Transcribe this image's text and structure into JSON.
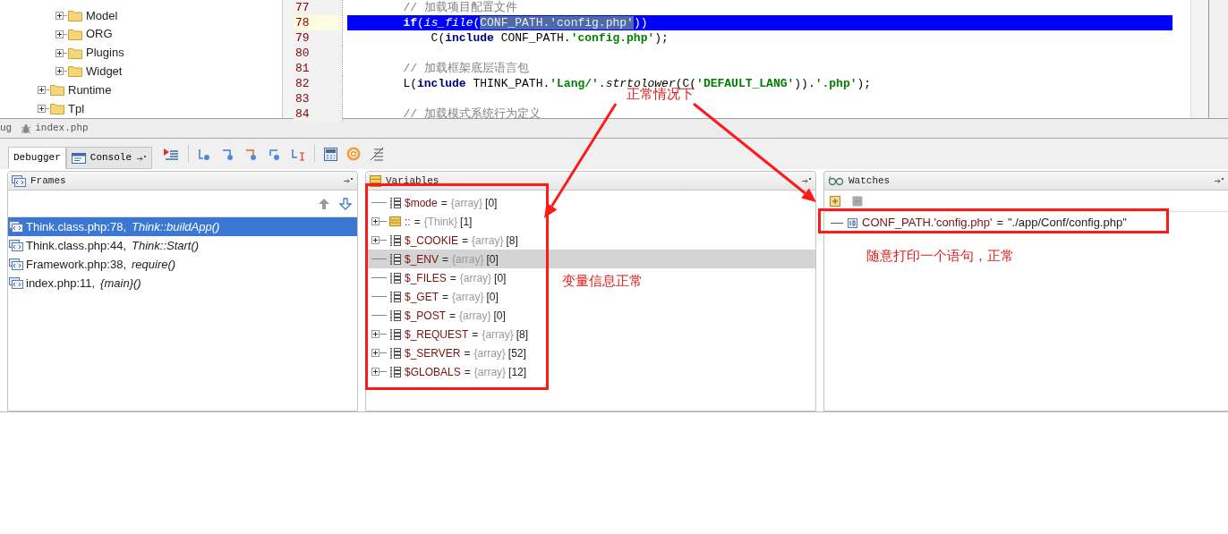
{
  "file_tree": [
    {
      "children": [
        {
          "label": "Model",
          "expanded": false
        },
        {
          "label": "ORG",
          "expanded": false
        },
        {
          "label": "Plugins",
          "expanded": false
        },
        {
          "label": "Widget",
          "expanded": false
        }
      ]
    },
    {
      "label": "Runtime",
      "expanded": false
    },
    {
      "label": "Tpl",
      "expanded": false
    }
  ],
  "editor": {
    "lines": [
      {
        "number": "77",
        "current": false,
        "tokens": [
          {
            "kind": "comment",
            "text": "        // 加载项目配置文件"
          }
        ]
      },
      {
        "number": "78",
        "current": true,
        "tokens": [
          {
            "kind": "keyword",
            "text": "        if"
          },
          {
            "kind": "plain",
            "text": "("
          },
          {
            "kind": "call",
            "text": "is_file"
          },
          {
            "kind": "plain",
            "text": "("
          },
          {
            "kind": "selected",
            "text": "CONF_PATH.'config.php'"
          },
          {
            "kind": "plain",
            "text": "))"
          }
        ]
      },
      {
        "number": "79",
        "current": false,
        "tokens": [
          {
            "kind": "plain",
            "text": "            C("
          },
          {
            "kind": "keyword",
            "text": "include"
          },
          {
            "kind": "plain",
            "text": " CONF_PATH."
          },
          {
            "kind": "string",
            "text": "'config.php'"
          },
          {
            "kind": "plain",
            "text": ");"
          }
        ]
      },
      {
        "number": "80",
        "current": false
      },
      {
        "number": "81",
        "current": false,
        "tokens": [
          {
            "kind": "comment",
            "text": "        // 加载框架底层语言包"
          }
        ]
      },
      {
        "number": "82",
        "current": false,
        "tokens": [
          {
            "kind": "plain",
            "text": "        L("
          },
          {
            "kind": "keyword",
            "text": "include"
          },
          {
            "kind": "plain",
            "text": " THINK_PATH."
          },
          {
            "kind": "string",
            "text": "'Lang/'"
          },
          {
            "kind": "plain",
            "text": "."
          },
          {
            "kind": "call",
            "text": "strtolower"
          },
          {
            "kind": "plain",
            "text": "(C("
          },
          {
            "kind": "string",
            "text": "'DEFAULT_LANG'"
          },
          {
            "kind": "plain",
            "text": "))."
          },
          {
            "kind": "string",
            "text": "'.php'"
          },
          {
            "kind": "plain",
            "text": ");"
          }
        ]
      },
      {
        "number": "83",
        "current": false
      },
      {
        "number": "84",
        "current": false,
        "tokens": [
          {
            "kind": "comment",
            "text": "        // 加载模式系统行为定义"
          }
        ]
      }
    ]
  },
  "session_tabs": [
    {
      "label": "ug"
    },
    {
      "label": "index.php"
    }
  ],
  "debug_tabs": [
    {
      "label": "Debugger",
      "selected": true
    },
    {
      "label": "Console",
      "selected": false
    }
  ],
  "frames": {
    "title": "Frames",
    "rows": [
      {
        "location": "Think.class.php:78,",
        "function": "Think::buildApp()",
        "selected": true
      },
      {
        "location": "Think.class.php:44,",
        "function": "Think::Start()",
        "selected": false
      },
      {
        "location": "Framework.php:38,",
        "function": "require()",
        "selected": false
      },
      {
        "location": "index.php:11,",
        "function": "{main}()",
        "selected": false
      }
    ]
  },
  "variables": {
    "title": "Variables",
    "rows": [
      {
        "kind": "array",
        "name": "$mode",
        "operator": "=",
        "type": "{array}",
        "count": "[0]",
        "expandable": false,
        "selected": false
      },
      {
        "kind": "object",
        "name": "::",
        "operator": "=",
        "type": "{Think}",
        "count": "[1]",
        "expandable": true,
        "selected": false
      },
      {
        "kind": "array",
        "name": "$_COOKIE",
        "operator": "=",
        "type": "{array}",
        "count": "[8]",
        "expandable": true,
        "selected": false
      },
      {
        "kind": "array",
        "name": "$_ENV",
        "operator": "=",
        "type": "{array}",
        "count": "[0]",
        "expandable": false,
        "selected": true
      },
      {
        "kind": "array",
        "name": "$_FILES",
        "operator": "=",
        "type": "{array}",
        "count": "[0]",
        "expandable": false,
        "selected": false
      },
      {
        "kind": "array",
        "name": "$_GET",
        "operator": "=",
        "type": "{array}",
        "count": "[0]",
        "expandable": false,
        "selected": false
      },
      {
        "kind": "array",
        "name": "$_POST",
        "operator": "=",
        "type": "{array}",
        "count": "[0]",
        "expandable": false,
        "selected": false
      },
      {
        "kind": "array",
        "name": "$_REQUEST",
        "operator": "=",
        "type": "{array}",
        "count": "[8]",
        "expandable": true,
        "selected": false
      },
      {
        "kind": "array",
        "name": "$_SERVER",
        "operator": "=",
        "type": "{array}",
        "count": "[52]",
        "expandable": true,
        "selected": false
      },
      {
        "kind": "array",
        "name": "$GLOBALS",
        "operator": "=",
        "type": "{array}",
        "count": "[12]",
        "expandable": true,
        "selected": false
      }
    ]
  },
  "watches": {
    "title": "Watches",
    "rows": [
      {
        "expression": "CONF_PATH.'config.php'",
        "operator": "=",
        "value": "\"./app/Conf/config.php\""
      }
    ]
  },
  "annotations": [
    {
      "text": "正常情况下"
    },
    {
      "text": "变量信息正常"
    },
    {
      "text": "随意打印一个语句，正常"
    }
  ]
}
